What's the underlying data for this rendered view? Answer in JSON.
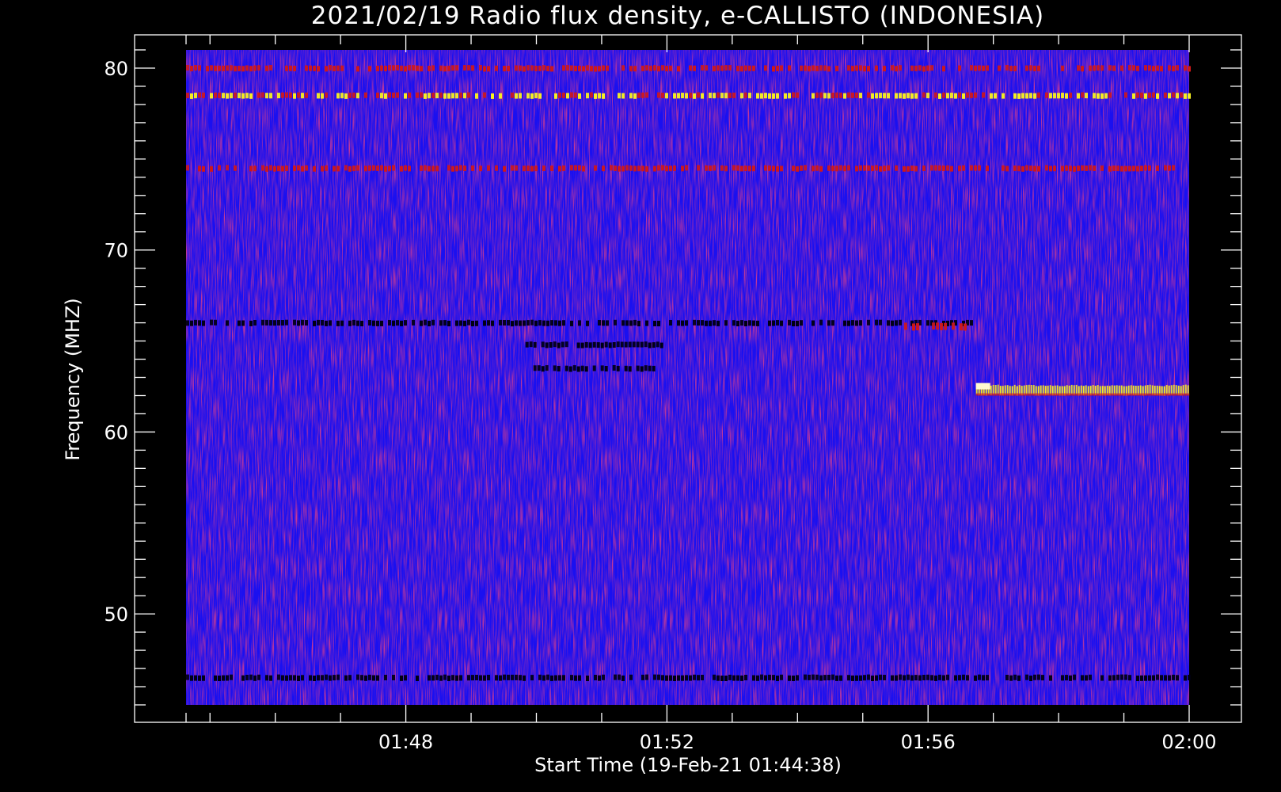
{
  "chart_data": {
    "type": "heatmap",
    "title": "2021/02/19  Radio flux density, e-CALLISTO (INDONESIA)",
    "xlabel": "Start Time (19-Feb-21 01:44:38)",
    "ylabel": "Frequency (MHZ)",
    "x_tick_labels": [
      "01:48",
      "01:52",
      "01:56",
      "02:00"
    ],
    "x_tick_minutes": [
      3.3667,
      7.3667,
      11.3667,
      15.3667
    ],
    "y_tick_labels": [
      "50",
      "60",
      "70",
      "80"
    ],
    "y_tick_values": [
      50,
      60,
      70,
      80
    ],
    "xlim_minutes": [
      0.0,
      15.3667
    ],
    "ylim_mhz": [
      81,
      45
    ],
    "y_reversed": true,
    "colormap": {
      "background": "#1a10f0",
      "low": "#000010",
      "mid": "#d01818",
      "high": "#f8f020",
      "peak": "#fff8d0"
    },
    "features": [
      {
        "kind": "strong-band",
        "freq_mhz": 62.3,
        "t_start": 12.1,
        "t_end": 15.37,
        "level": "high"
      },
      {
        "kind": "warm-band",
        "freq_mhz": 78.5,
        "t_start": 0.0,
        "t_end": 15.37,
        "level": "mid-high"
      },
      {
        "kind": "warm-band",
        "freq_mhz": 80.0,
        "t_start": 0.0,
        "t_end": 15.37,
        "level": "mid"
      },
      {
        "kind": "warm-band",
        "freq_mhz": 74.5,
        "t_start": 0.0,
        "t_end": 15.37,
        "level": "mid"
      },
      {
        "kind": "dark-band",
        "freq_mhz": 66.0,
        "t_start": 0.0,
        "t_end": 12.1,
        "level": "low"
      },
      {
        "kind": "dark-band",
        "freq_mhz": 64.8,
        "t_start": 5.2,
        "t_end": 7.3,
        "level": "low"
      },
      {
        "kind": "dark-band",
        "freq_mhz": 63.5,
        "t_start": 5.2,
        "t_end": 7.3,
        "level": "low"
      },
      {
        "kind": "warm-patch",
        "freq_mhz": 65.8,
        "t_start": 11.0,
        "t_end": 12.0,
        "level": "mid"
      },
      {
        "kind": "dark-band",
        "freq_mhz": 46.5,
        "t_start": 0.0,
        "t_end": 15.37,
        "level": "low"
      }
    ]
  }
}
